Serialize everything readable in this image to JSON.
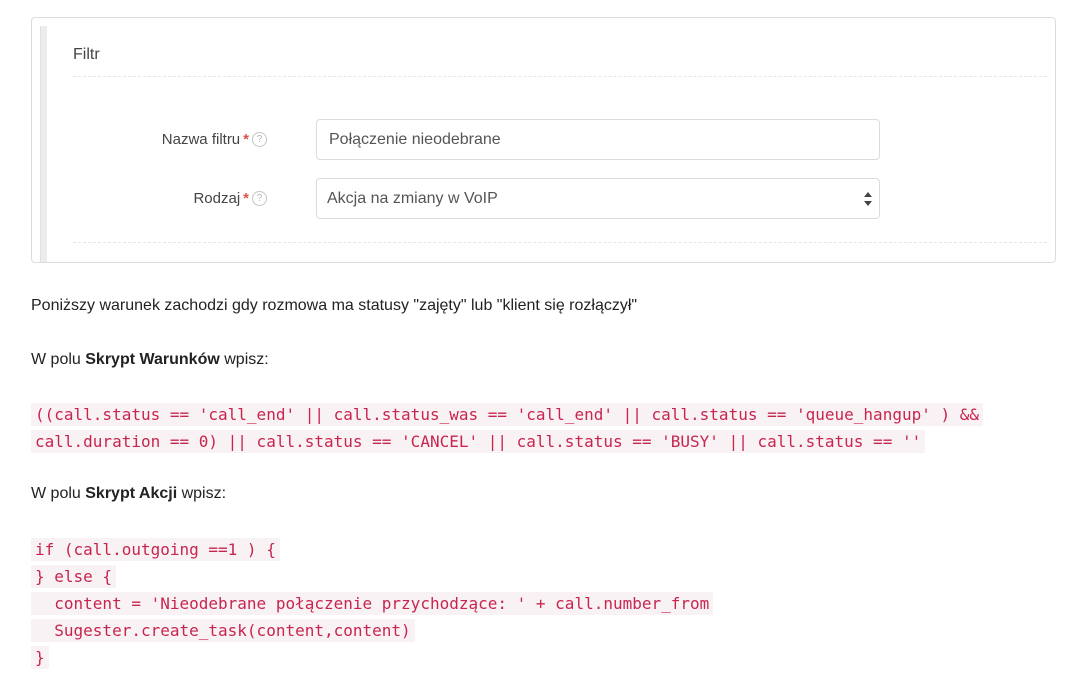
{
  "filter_panel": {
    "title": "Filtr",
    "fields": [
      {
        "label": "Nazwa filtru",
        "required_mark": "*",
        "help_glyph": "?",
        "value": "Połączenie nieodebrane"
      },
      {
        "label": "Rodzaj",
        "required_mark": "*",
        "help_glyph": "?",
        "selected_option": "Akcja na zmiany w VoIP"
      }
    ]
  },
  "content": {
    "paragraph_1": "Poniższy warunek zachodzi gdy rozmowa ma statusy \"zajęty\" lub \"klient się rozłączył\"",
    "paragraph_2": {
      "prefix": "W polu ",
      "bold": "Skrypt Warunków",
      "suffix": " wpisz:"
    },
    "condition_script_lines": [
      "((call.status == 'call_end' || call.status_was == 'call_end' || call.status == 'queue_hangup' ) &&",
      "call.duration == 0) || call.status == 'CANCEL' || call.status == 'BUSY' || call.status == ''"
    ],
    "paragraph_3": {
      "prefix": "W polu ",
      "bold": "Skrypt Akcji",
      "suffix": " wpisz:"
    },
    "action_script_lines": [
      "if (call.outgoing ==1 ) {",
      "} else {",
      "  content = 'Nieodebrane połączenie przychodzące: ' + call.number_from",
      "  Sugester.create_task(content,content)",
      "}"
    ]
  },
  "icons": {
    "help": "question-circle-icon",
    "select_arrows": "sort-arrows-icon"
  },
  "colors": {
    "required": "#d9534f",
    "code_text": "#c7254e",
    "code_background": "#f9f2f4"
  }
}
